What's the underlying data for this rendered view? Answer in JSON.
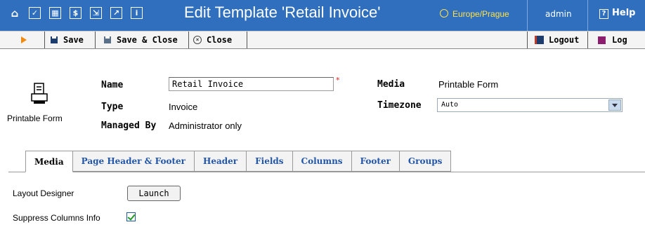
{
  "header": {
    "title": "Edit Template 'Retail Invoice'",
    "timezone_link": "Europe/Prague",
    "user": "admin",
    "help_label": "Help",
    "icons": [
      "home-icon",
      "checklist-icon",
      "grid-icon",
      "dollar-icon",
      "import-icon",
      "chart-icon",
      "info-icon"
    ]
  },
  "toolbar": {
    "save_label": "Save",
    "save_close_label": "Save & Close",
    "close_label": "Close",
    "logout_label": "Logout",
    "log_label": "Log"
  },
  "form": {
    "media_icon_label": "Printable Form",
    "name_label": "Name",
    "name_value": "Retail Invoice",
    "required_mark": "*",
    "type_label": "Type",
    "type_value": "Invoice",
    "managed_by_label": "Managed By",
    "managed_by_value": "Administrator only",
    "media_label": "Media",
    "media_value": "Printable Form",
    "timezone_label": "Timezone",
    "timezone_value": "Auto"
  },
  "tabs": [
    {
      "label": "Media",
      "active": true
    },
    {
      "label": "Page Header & Footer"
    },
    {
      "label": "Header"
    },
    {
      "label": "Fields"
    },
    {
      "label": "Columns"
    },
    {
      "label": "Footer"
    },
    {
      "label": "Groups"
    }
  ],
  "media_tab": {
    "layout_designer_label": "Layout Designer",
    "launch_label": "Launch",
    "suppress_label": "Suppress Columns Info",
    "suppress_checked": true
  },
  "colors": {
    "header_bg": "#2f6fbe",
    "timezone_link": "#ffe14a",
    "tab_link": "#2256a8"
  }
}
